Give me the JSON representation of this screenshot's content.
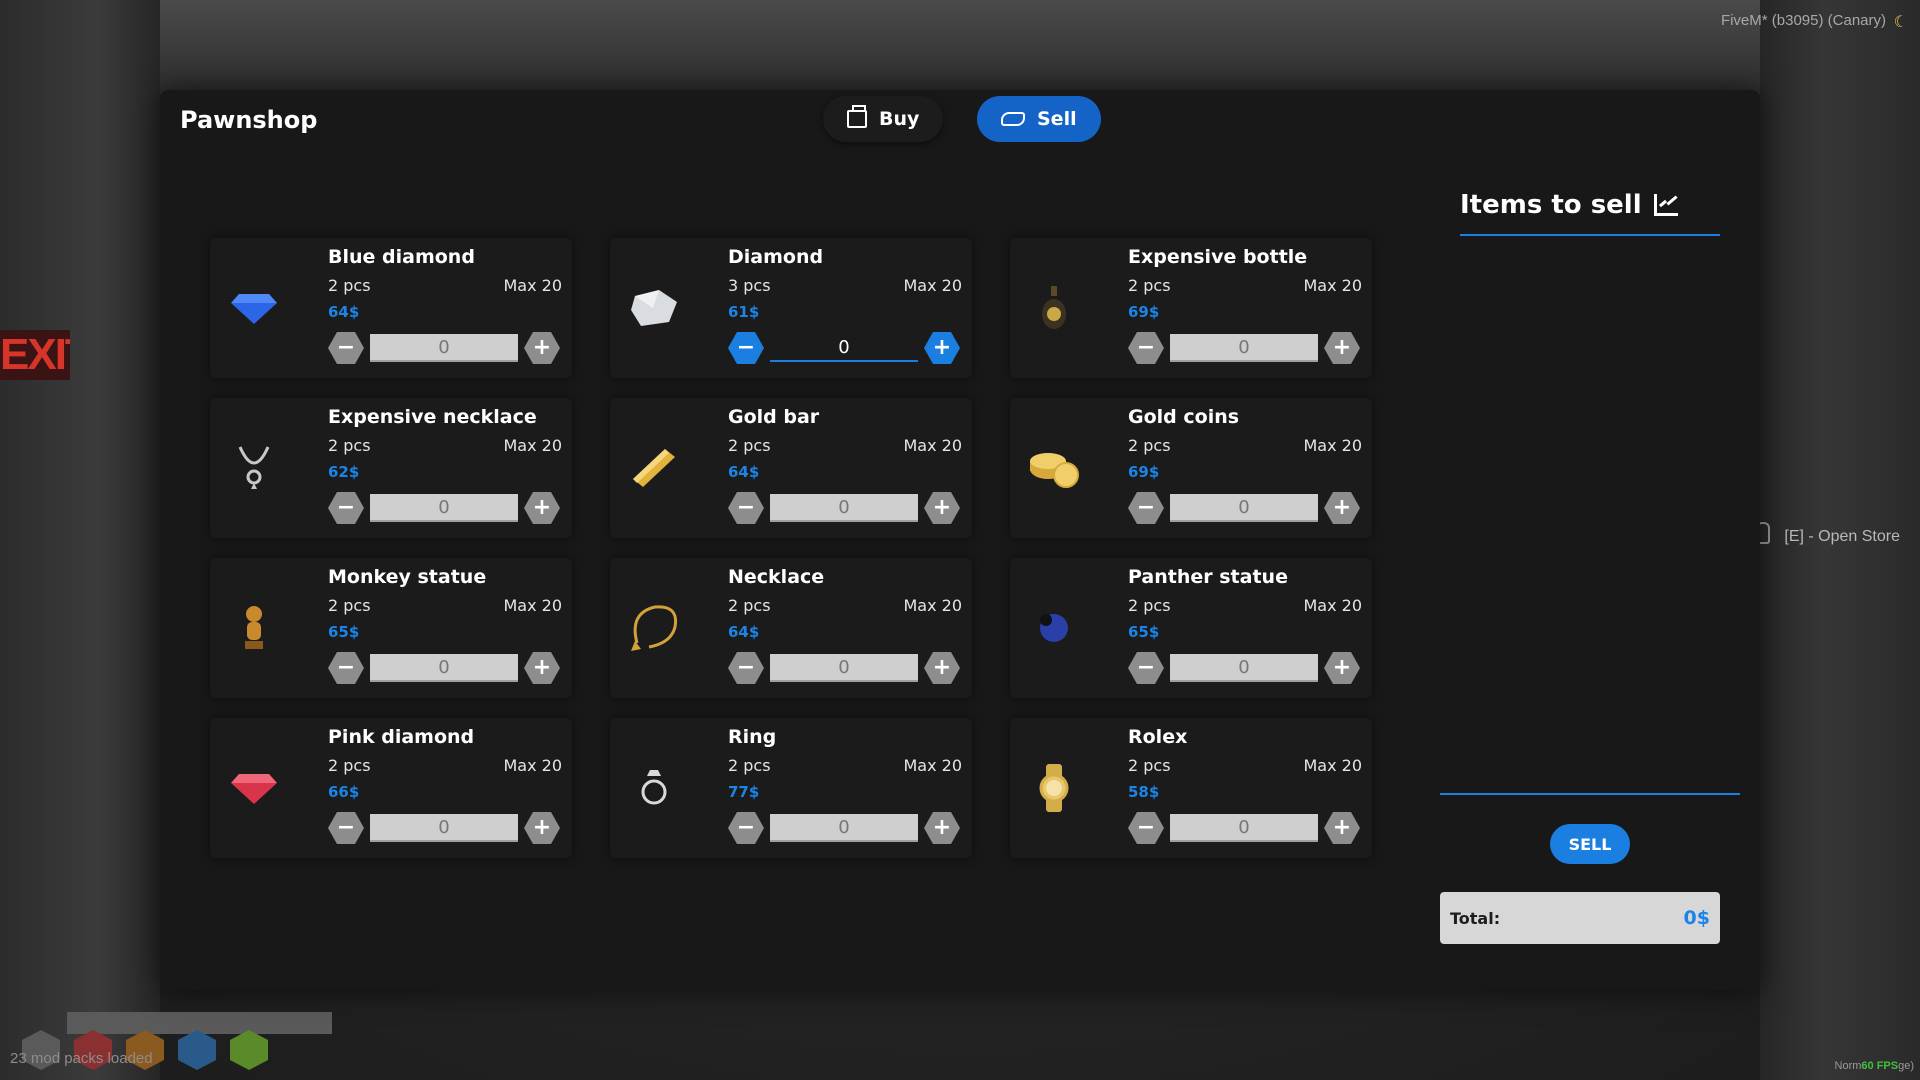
{
  "overlay": {
    "fivem": "FiveM* (b3095) (Canary)",
    "open_store": "[E] - Open Store",
    "mods_loaded": "23 mod packs loaded",
    "fps_prefix": "Norm",
    "fps": "60 FPS",
    "fps_suffix": "ge)",
    "exit_sign": "EXIT>"
  },
  "shop": {
    "title": "Pawnshop",
    "tabs": {
      "buy": "Buy",
      "sell": "Sell"
    },
    "items_heading": "Items to sell",
    "sell_button": "SELL",
    "total_label": "Total:",
    "total_value": "0$"
  },
  "items": [
    {
      "name": "Blue diamond",
      "qty": "2 pcs",
      "max": "Max 20",
      "price": "64$",
      "value": "0",
      "icon": "blue-diamond-icon",
      "color": "#2a66e6"
    },
    {
      "name": "Diamond",
      "qty": "3 pcs",
      "max": "Max 20",
      "price": "61$",
      "value": "0",
      "icon": "diamond-icon",
      "color": "#d9dde2"
    },
    {
      "name": "Expensive bottle",
      "qty": "2 pcs",
      "max": "Max 20",
      "price": "69$",
      "value": "0",
      "icon": "bottle-icon",
      "color": "#c9a84a"
    },
    {
      "name": "Expensive necklace",
      "qty": "2 pcs",
      "max": "Max 20",
      "price": "62$",
      "value": "0",
      "icon": "necklace-pendant-icon",
      "color": "#c8c8c8"
    },
    {
      "name": "Gold bar",
      "qty": "2 pcs",
      "max": "Max 20",
      "price": "64$",
      "value": "0",
      "icon": "gold-bar-icon",
      "color": "#e1b23c"
    },
    {
      "name": "Gold coins",
      "qty": "2 pcs",
      "max": "Max 20",
      "price": "69$",
      "value": "0",
      "icon": "gold-coins-icon",
      "color": "#d8a93a"
    },
    {
      "name": "Monkey statue",
      "qty": "2 pcs",
      "max": "Max 20",
      "price": "65$",
      "value": "0",
      "icon": "monkey-statue-icon",
      "color": "#c98a2e"
    },
    {
      "name": "Necklace",
      "qty": "2 pcs",
      "max": "Max 20",
      "price": "64$",
      "value": "0",
      "icon": "necklace-icon",
      "color": "#d1a13a"
    },
    {
      "name": "Panther statue",
      "qty": "2 pcs",
      "max": "Max 20",
      "price": "65$",
      "value": "0",
      "icon": "panther-statue-icon",
      "color": "#2a3fa8"
    },
    {
      "name": "Pink diamond",
      "qty": "2 pcs",
      "max": "Max 20",
      "price": "66$",
      "value": "0",
      "icon": "pink-diamond-icon",
      "color": "#d8344a"
    },
    {
      "name": "Ring",
      "qty": "2 pcs",
      "max": "Max 20",
      "price": "77$",
      "value": "0",
      "icon": "ring-icon",
      "color": "#d9d9d9"
    },
    {
      "name": "Rolex",
      "qty": "2 pcs",
      "max": "Max 20",
      "price": "58$",
      "value": "0",
      "icon": "rolex-icon",
      "color": "#d4ad4a"
    }
  ],
  "colors": {
    "accent": "#1a7fe0",
    "panel": "#181818"
  }
}
